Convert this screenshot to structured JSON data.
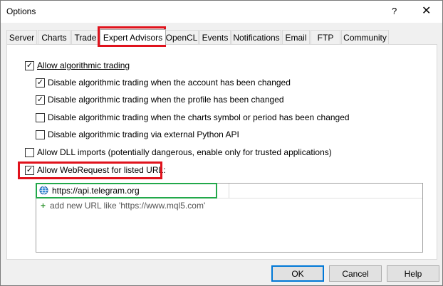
{
  "window": {
    "title": "Options",
    "help": "?",
    "close": "✕"
  },
  "tabs": [
    "Server",
    "Charts",
    "Trade",
    "Expert Advisors",
    "OpenCL",
    "Events",
    "Notifications",
    "Email",
    "FTP",
    "Community"
  ],
  "active_tab": "Expert Advisors",
  "options": {
    "allow_algo": {
      "label": "Allow algorithmic trading",
      "checked": true
    },
    "disable_account": {
      "label": "Disable algorithmic trading when the account has been changed",
      "checked": true
    },
    "disable_profile": {
      "label": "Disable algorithmic trading when the profile has been changed",
      "checked": true
    },
    "disable_symbol": {
      "label": "Disable algorithmic trading when the charts symbol or period has been changed",
      "checked": false
    },
    "disable_python": {
      "label": "Disable algorithmic trading via external Python API",
      "checked": false
    },
    "allow_dll": {
      "label": "Allow DLL imports (potentially dangerous, enable only for trusted applications)",
      "checked": false
    },
    "allow_webrequest": {
      "label": "Allow WebRequest for listed URL:",
      "checked": true
    }
  },
  "urls": {
    "entry": "https://api.telegram.org",
    "add_hint": "add new URL like 'https://www.mql5.com'"
  },
  "buttons": {
    "ok": "OK",
    "cancel": "Cancel",
    "help": "Help"
  },
  "highlight_colors": {
    "red": "#e0121c",
    "green": "#22a84a"
  }
}
